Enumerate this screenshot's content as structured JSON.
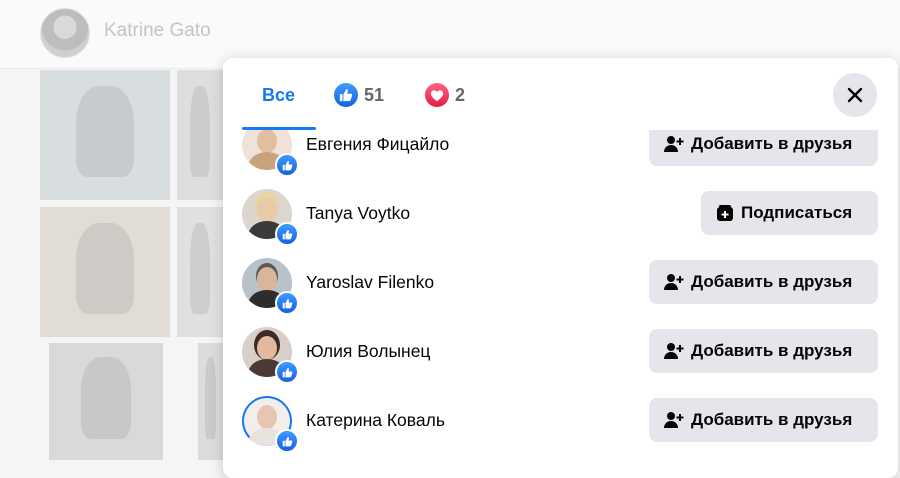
{
  "background": {
    "profile_name": "Katrine Gato"
  },
  "modal": {
    "tabs": [
      {
        "label": "Все",
        "active": true
      },
      {
        "label": "51",
        "icon": "like-icon",
        "color": "#1877f2"
      },
      {
        "label": "2",
        "icon": "heart-icon",
        "color": "#f33e58"
      }
    ],
    "close_icon": "close-icon",
    "people": [
      {
        "name": "Евгения Фицайло",
        "button": "Добавить в друзья",
        "button_icon": "add-friend-icon",
        "reaction": "like"
      },
      {
        "name": "Tanya Voytko",
        "button": "Подписаться",
        "button_icon": "follow-icon",
        "reaction": "like"
      },
      {
        "name": "Yaroslav Filenko",
        "button": "Добавить в друзья",
        "button_icon": "add-friend-icon",
        "reaction": "like"
      },
      {
        "name": "Юлия Волынец",
        "button": "Добавить в друзья",
        "button_icon": "add-friend-icon",
        "reaction": "like"
      },
      {
        "name": "Катерина Коваль",
        "button": "Добавить в друзья",
        "button_icon": "add-friend-icon",
        "reaction": "like"
      }
    ]
  },
  "colors": {
    "accent": "#1877f2",
    "button_bg": "#e4e6eb",
    "text": "#050505",
    "muted": "#65676b"
  }
}
